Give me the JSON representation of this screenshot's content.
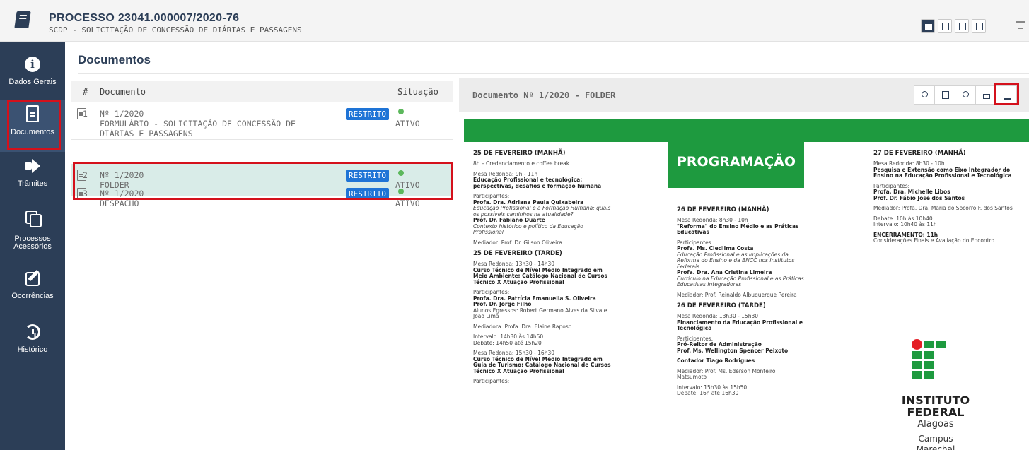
{
  "header": {
    "process_title": "PROCESSO 23041.000007/2020-76",
    "process_subtitle": "SCDP - SOLICITAÇÃO DE CONCESSÃO DE DIÁRIAS E PASSAGENS",
    "toolbar_icons": [
      "folder-open-icon",
      "file-icon",
      "copy-icon",
      "pdf-icon",
      "filter-icon"
    ]
  },
  "sidebar": {
    "items": [
      {
        "label": "Dados Gerais",
        "icon": "info-icon"
      },
      {
        "label": "Documentos",
        "icon": "document-icon"
      },
      {
        "label": "Trâmites",
        "icon": "sign-out-icon"
      },
      {
        "label": "Processos Acessórios",
        "icon": "copy-icon"
      },
      {
        "label": "Ocorrências",
        "icon": "edit-icon"
      },
      {
        "label": "Histórico",
        "icon": "history-icon"
      }
    ],
    "active": "Documentos",
    "accent": "#2c3e57"
  },
  "documents": {
    "heading": "Documentos",
    "columns": {
      "num": "#",
      "doc": "Documento",
      "status": "Situação"
    },
    "rows": [
      {
        "num": "1",
        "title": "Nº 1/2020",
        "desc": "FORMULÁRIO - SOLICITAÇÃO DE CONCESSÃO DE DIÁRIAS E PASSAGENS",
        "desc_l1": "FORMULÁRIO - SOLICITAÇÃO DE CONCESSÃO DE",
        "desc_l2": "DIÁRIAS E PASSAGENS",
        "badge": "RESTRITO",
        "status": "ATIVO"
      },
      {
        "num": "2",
        "title": "Nº 1/2020",
        "desc": "FOLDER",
        "badge": "RESTRITO",
        "status": "ATIVO"
      },
      {
        "num": "3",
        "title": "Nº 1/2020",
        "desc": "DESPACHO",
        "badge": "RESTRITO",
        "status": "ATIVO"
      }
    ],
    "selected_row": 2,
    "badge_color": "#1f74d6",
    "status_color": "#5cb85c",
    "highlight_color": "#d4111c"
  },
  "viewer": {
    "title": "Documento Nº 1/2020 - FOLDER",
    "buttons": [
      "search-icon",
      "file-search-icon",
      "users-icon",
      "lock-icon",
      "download-icon"
    ],
    "folder": {
      "heading": "PROGRAMAÇÃO",
      "col1": {
        "h1": "25 DE FEVEREIRO (MANHÃ)",
        "l1": "8h – Credenciamento e coffee break",
        "l2": "Mesa Redonda: 9h - 11h",
        "l3": "Educação Profissional e tecnológica: perspectivas, desafios e formação humana",
        "l4": "Participantes:",
        "l5": "Profa. Dra. Adriana Paula Quixabeira",
        "l6": "Educação Profissional e a Formação Humana: quais os possíveis caminhos na atualidade?",
        "l7": "Prof. Dr. Fabiano Duarte",
        "l8": "Contexto histórico e político da Educação Profissional",
        "l9": "Mediador: Prof. Dr. Gilson Oliveira",
        "h2": "25 DE FEVEREIRO (TARDE)",
        "l10": "Mesa Redonda: 13h30 - 14h30",
        "l11": "Curso Técnico de Nível Médio Integrado em Meio Ambiente: Catálogo Nacional de Cursos Técnico X Atuação Profissional",
        "l12": "Participantes:",
        "l13": "Profa. Dra. Patrícia Emanuella S. Oliveira",
        "l14": "Prof. Dr. Jorge Filho",
        "l15": "Alunos Egressos: Robert Germano Alves da Silva e João Lima",
        "l16": "Mediadora: Profa. Dra. Elaine Raposo",
        "l17": "Intervalo: 14h30 às 14h50",
        "l18": "Debate: 14h50 até 15h20",
        "l19": "Mesa Redonda: 15h30 - 16h30",
        "l20": "Curso Técnico de Nível Médio Integrado em Guia de Turismo: Catálogo Nacional de Cursos Técnico X Atuação Profissional",
        "l21": "Participantes:"
      },
      "col2": {
        "h1": "26 DE FEVEREIRO (MANHÃ)",
        "l1": "Mesa Redonda: 8h30 - 10h",
        "l2": "\"Reforma\" do Ensino Médio e as Práticas Educativas",
        "l3": "Participantes:",
        "l4": "Profa. Ms. Cledilma Costa",
        "l5": "Educação Profissional e as implicações da Reforma do Ensino e da BNCC nos Institutos Federais",
        "l6": "Profa. Dra. Ana Cristina Limeira",
        "l7": "Currículo na Educação Profissional e as Práticas Educativas Integradoras",
        "l8": "Mediador: Prof. Reinaldo Albuquerque Pereira",
        "h2": "26 DE FEVEREIRO (TARDE)",
        "l9": "Mesa Redonda: 13h30 - 15h30",
        "l10": "Financiamento da Educação Profissional e Tecnológica",
        "l11": "Participantes:",
        "l12": "Pró-Reitor de Administração",
        "l13": "Prof. Ms. Wellington Spencer Peixoto",
        "l14": "Contador Tiago Rodrigues",
        "l15": "Mediador: Prof. Ms. Ederson Monteiro Matsumoto",
        "l16": "Intervalo: 15h30 às 15h50",
        "l17": "Debate: 16h até 16h30"
      },
      "col3": {
        "h1": "27 DE FEVEREIRO (MANHÃ)",
        "l1": "Mesa Redonda: 8h30 - 10h",
        "l2": "Pesquisa e Extensão como Eixo Integrador do Ensino na Educação Profissional e Tecnológica",
        "l3": "Participantes:",
        "l4": "Profa. Dra. Michelle Libos",
        "l5": "Prof. Dr. Fábio José dos Santos",
        "l6": "Mediador: Profa. Dra. Maria do Socorro F. dos Santos",
        "l7": "Debate: 10h às 10h40",
        "l8": "Intervalo: 10h40 às 11h",
        "l9": "ENCERRAMENTO: 11h",
        "l10": "Considerações Finais e Avaliação do Encontro"
      },
      "logo": {
        "line1": "INSTITUTO",
        "line2": "FEDERAL",
        "line3": "Alagoas",
        "line4": "Campus",
        "line5": "Marechal"
      },
      "green": "#1e9a3f",
      "red": "#e41e26"
    }
  }
}
